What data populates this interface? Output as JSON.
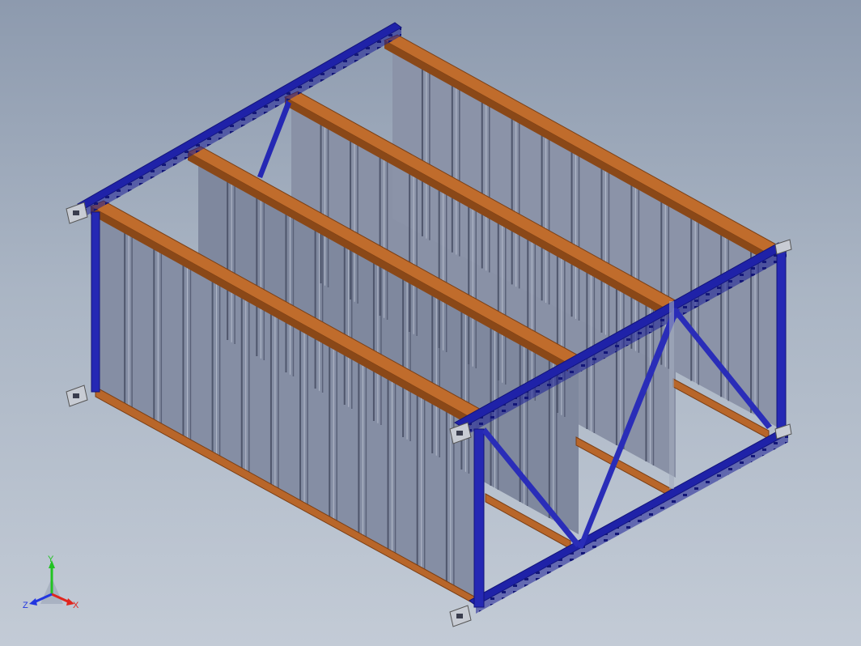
{
  "viewport": {
    "background_top": "#8d9aae",
    "background_bottom": "#c3cbd6"
  },
  "model": {
    "colors": {
      "blue_frame": "#1f22a8",
      "blue_frame_dark": "#12147a",
      "orange_beam": "#b8662a",
      "orange_beam_dark": "#7c3f14",
      "panel": "#858ea4",
      "panel_dark": "#5f6780",
      "panel_light": "#a3abbe",
      "base_plate": "#c8ccd4"
    }
  },
  "triad": {
    "x_label": "X",
    "y_label": "Y",
    "z_label": "Z",
    "x_color": "#e0261e",
    "y_color": "#22c323",
    "z_color": "#2236e0"
  }
}
